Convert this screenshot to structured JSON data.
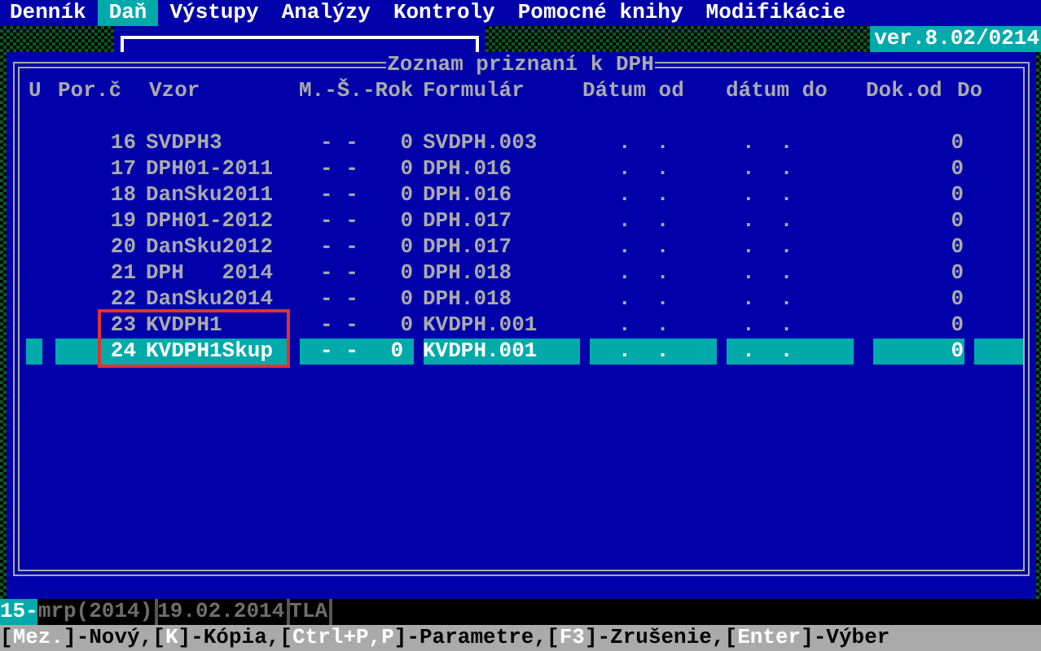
{
  "menu": [
    {
      "label": "Denník",
      "selected": false
    },
    {
      "label": "Daň",
      "selected": true
    },
    {
      "label": "Výstupy",
      "selected": false
    },
    {
      "label": "Analýzy",
      "selected": false
    },
    {
      "label": "Kontroly",
      "selected": false
    },
    {
      "label": "Pomocné knihy",
      "selected": false
    },
    {
      "label": "Modifikácie",
      "selected": false
    }
  ],
  "version": "ver.8.02/0214",
  "window": {
    "title": "Zoznam priznaní k DPH"
  },
  "table": {
    "columns": [
      "U",
      "Por.č",
      "Vzor",
      "M.-Š.-Rok",
      "Formulár",
      "Dátum od",
      "dátum do",
      "Dok.od",
      "Do"
    ],
    "rows": [
      {
        "num": "16",
        "vzor": "SVDPH3",
        "ms": "- -",
        "rok": "0",
        "formular": "SVDPH.003",
        "datum_od": ".  .",
        "datum_do": ".  .",
        "dok_od": "0",
        "selected": false,
        "marked": false
      },
      {
        "num": "17",
        "vzor": "DPH01-2011",
        "ms": "- -",
        "rok": "0",
        "formular": "DPH.016",
        "datum_od": ".  .",
        "datum_do": ".  .",
        "dok_od": "0",
        "selected": false,
        "marked": false
      },
      {
        "num": "18",
        "vzor": "DanSku2011",
        "ms": "- -",
        "rok": "0",
        "formular": "DPH.016",
        "datum_od": ".  .",
        "datum_do": ".  .",
        "dok_od": "0",
        "selected": false,
        "marked": false
      },
      {
        "num": "19",
        "vzor": "DPH01-2012",
        "ms": "- -",
        "rok": "0",
        "formular": "DPH.017",
        "datum_od": ".  .",
        "datum_do": ".  .",
        "dok_od": "0",
        "selected": false,
        "marked": false
      },
      {
        "num": "20",
        "vzor": "DanSku2012",
        "ms": "- -",
        "rok": "0",
        "formular": "DPH.017",
        "datum_od": ".  .",
        "datum_do": ".  .",
        "dok_od": "0",
        "selected": false,
        "marked": false
      },
      {
        "num": "21",
        "vzor": "DPH   2014",
        "ms": "- -",
        "rok": "0",
        "formular": "DPH.018",
        "datum_od": ".  .",
        "datum_do": ".  .",
        "dok_od": "0",
        "selected": false,
        "marked": false
      },
      {
        "num": "22",
        "vzor": "DanSku2014",
        "ms": "- -",
        "rok": "0",
        "formular": "DPH.018",
        "datum_od": ".  .",
        "datum_do": ".  .",
        "dok_od": "0",
        "selected": false,
        "marked": false
      },
      {
        "num": "23",
        "vzor": "KVDPH1",
        "ms": "- -",
        "rok": "0",
        "formular": "KVDPH.001",
        "datum_od": ".  .",
        "datum_do": ".  .",
        "dok_od": "0",
        "selected": false,
        "marked": true
      },
      {
        "num": "24",
        "vzor": "KVDPH1Skup",
        "ms": "- -",
        "rok": "0",
        "formular": "KVDPH.001",
        "datum_od": ".  .",
        "datum_do": ".  .",
        "dok_od": "0",
        "selected": true,
        "marked": true
      }
    ]
  },
  "status_bar": {
    "page": "15-",
    "fields": [
      "mrp(2014)",
      "19.02.2014",
      "TLA"
    ]
  },
  "shortcuts": "[**Mez.**]-Nový,[**K**]-Kópia,[**Ctrl+P,P**]-Parametre,[**F3**]-Zrušenie,[**Enter**]-Výber"
}
